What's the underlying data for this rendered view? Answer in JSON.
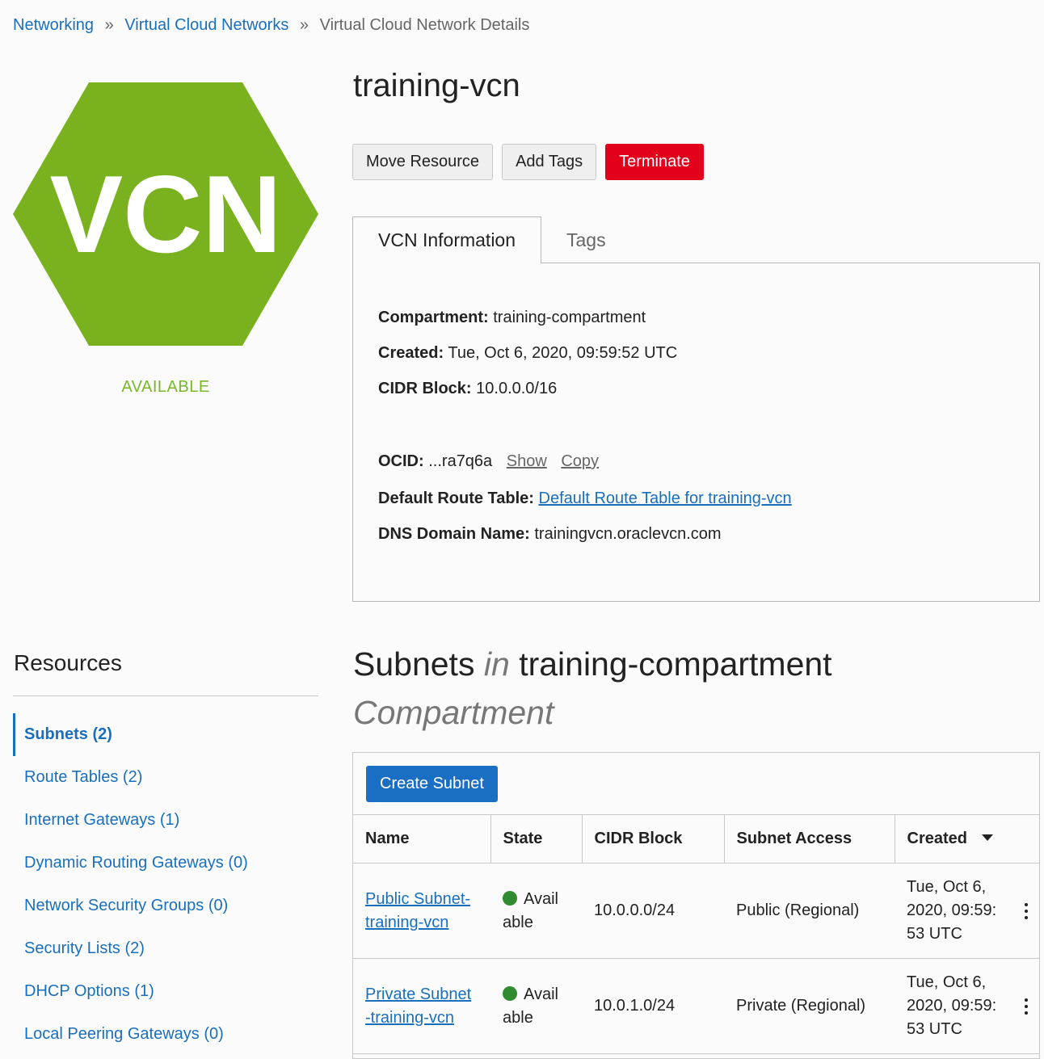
{
  "breadcrumb": {
    "items": [
      "Networking",
      "Virtual Cloud Networks"
    ],
    "current": "Virtual Cloud Network Details",
    "separator": "»"
  },
  "resource": {
    "icon_text": "VCN",
    "icon_color": "#7ab21f",
    "status": "AVAILABLE",
    "status_color": "#7ab829",
    "name": "training-vcn"
  },
  "actions": {
    "move": "Move Resource",
    "add_tags": "Add Tags",
    "terminate": "Terminate"
  },
  "tabs": {
    "info": "VCN Information",
    "tags": "Tags"
  },
  "info": {
    "compartment_label": "Compartment:",
    "compartment": "training-compartment",
    "created_label": "Created:",
    "created": "Tue, Oct 6, 2020, 09:59:52 UTC",
    "cidr_label": "CIDR Block:",
    "cidr": "10.0.0.0/16",
    "ocid_label": "OCID:",
    "ocid": "...ra7q6a",
    "show": "Show",
    "copy": "Copy",
    "route_table_label": "Default Route Table:",
    "route_table": "Default Route Table for training-vcn",
    "dns_label": "DNS Domain Name:",
    "dns": "trainingvcn.oraclevcn.com"
  },
  "resources": {
    "title": "Resources",
    "items": [
      {
        "label": "Subnets (2)"
      },
      {
        "label": "Route Tables (2)"
      },
      {
        "label": "Internet Gateways (1)"
      },
      {
        "label": "Dynamic Routing Gateways (0)"
      },
      {
        "label": "Network Security Groups (0)"
      },
      {
        "label": "Security Lists (2)"
      },
      {
        "label": "DHCP Options (1)"
      },
      {
        "label": "Local Peering Gateways (0)"
      }
    ]
  },
  "subnets": {
    "title_main": "Subnets",
    "title_in": "in",
    "title_compartment": "training-compartment",
    "title_suffix": "Compartment",
    "create_button": "Create Subnet",
    "columns": [
      "Name",
      "State",
      "CIDR Block",
      "Subnet Access",
      "Created"
    ],
    "rows": [
      {
        "name_l1": "Public Subnet-",
        "name_l2": "training-vcn",
        "state_l1": "Avail",
        "state_l2": "able",
        "cidr": "10.0.0.0/24",
        "access": "Public (Regional)",
        "created_l1": "Tue, Oct 6,",
        "created_l2": "2020, 09:59:",
        "created_l3": "53 UTC"
      },
      {
        "name_l1": "Private Subnet",
        "name_l2": "-training-vcn",
        "state_l1": "Avail",
        "state_l2": "able",
        "cidr": "10.0.1.0/24",
        "access": "Private (Regional)",
        "created_l1": "Tue, Oct 6,",
        "created_l2": "2020, 09:59:",
        "created_l3": "53 UTC"
      }
    ]
  }
}
